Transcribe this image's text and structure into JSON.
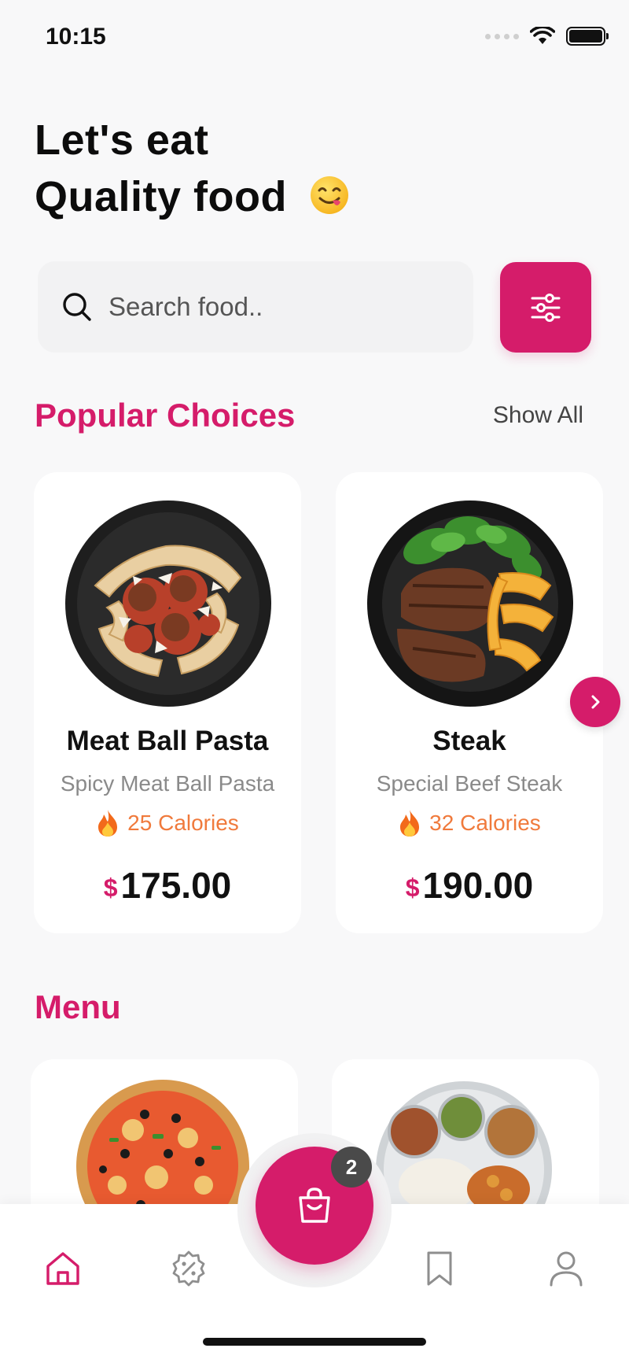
{
  "status_bar": {
    "time": "10:15"
  },
  "header": {
    "line1": "Let's eat",
    "line2": "Quality food"
  },
  "search": {
    "placeholder": "Search food.."
  },
  "popular": {
    "title": "Popular Choices",
    "show_all": "Show All",
    "items": [
      {
        "name": "Meat Ball Pasta",
        "description": "Spicy Meat Ball Pasta",
        "calories": "25 Calories",
        "currency": "$",
        "price": "175.00"
      },
      {
        "name": "Steak",
        "description": "Special Beef Steak",
        "calories": "32 Calories",
        "currency": "$",
        "price": "190.00"
      }
    ]
  },
  "menu": {
    "title": "Menu"
  },
  "cart": {
    "badge_count": "2"
  },
  "nav": {
    "items": [
      {
        "icon": "home-icon",
        "active": true
      },
      {
        "icon": "offers-icon",
        "active": false
      },
      {
        "icon": "bookmark-icon",
        "active": false
      },
      {
        "icon": "profile-icon",
        "active": false
      }
    ]
  },
  "colors": {
    "accent": "#d51c6a",
    "calories": "#f07a3c",
    "background": "#f8f8f9"
  }
}
